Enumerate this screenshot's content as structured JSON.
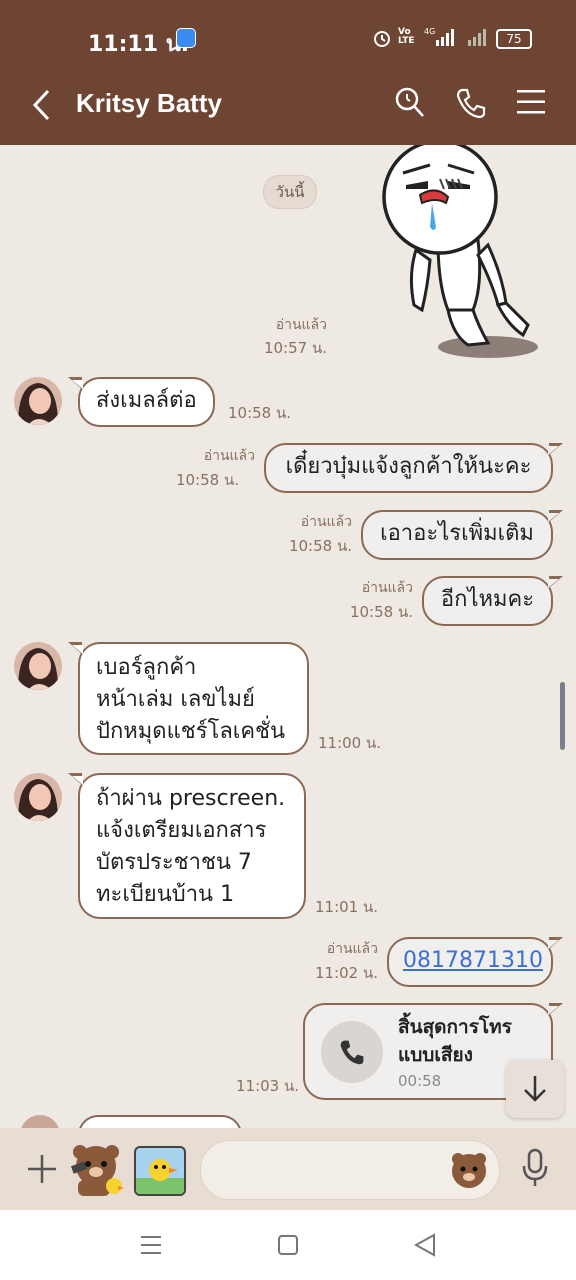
{
  "status_bar": {
    "time": "11:11 น.",
    "network": "Vo LTE 4G",
    "battery": "75"
  },
  "header": {
    "back_icon": "chevron-left-icon",
    "contact_name": "Kritsy Batty",
    "search_icon": "search-icon",
    "call_icon": "phone-icon",
    "menu_icon": "hamburger-menu-icon"
  },
  "chat": {
    "date_chip": "วันนี้",
    "sticker_read": "อ่านแล้ว",
    "sticker_time": "10:57 น.",
    "messages": [
      {
        "text": "ส่งเมลล์ต่อ",
        "time": "10:58 น."
      },
      {
        "read": "อ่านแล้ว",
        "time": "10:58 น.",
        "text": "เดี๋ยวบุ๋มแจ้งลูกค้าให้นะคะ"
      },
      {
        "read": "อ่านแล้ว",
        "time": "10:58 น.",
        "text": "เอาอะไรเพิ่มเติม"
      },
      {
        "read": "อ่านแล้ว",
        "time": "10:58 น.",
        "text": "อีกไหมคะ"
      },
      {
        "lines": [
          "เบอร์ลูกค้า",
          "หน้าเล่ม เลขไมย์",
          "ปักหมุดแชร์โลเคชั่น"
        ],
        "time": "11:00 น."
      },
      {
        "lines": [
          "ถ้าผ่าน prescreen.",
          "แจ้งเตรียมเอกสาร",
          "บัตรประชาชน 7",
          "ทะเบียนบ้าน 1"
        ],
        "time": "11:01 น."
      },
      {
        "read": "อ่านแล้ว",
        "time": "11:02 น.",
        "link": "0817871310"
      },
      {
        "time": "11:03 น.",
        "call_title_1": "สิ้นสุดการโทร",
        "call_title_2": "แบบเสียง",
        "call_duration": "00:58"
      }
    ],
    "scroll_down_icon": "arrow-down-icon"
  },
  "input_bar": {
    "add_icon": "plus-icon",
    "message_value": "",
    "emoji_icon": "bear-emoji-icon",
    "mic_icon": "microphone-icon"
  },
  "nav_bar": {
    "menu": "recent-apps-icon",
    "home": "home-icon",
    "back": "back-triangle-icon"
  },
  "colors": {
    "header": "#6e4432",
    "chat_bg": "#efe9e3",
    "bubble_border": "#8a6a55",
    "link": "#3b6fd8"
  }
}
